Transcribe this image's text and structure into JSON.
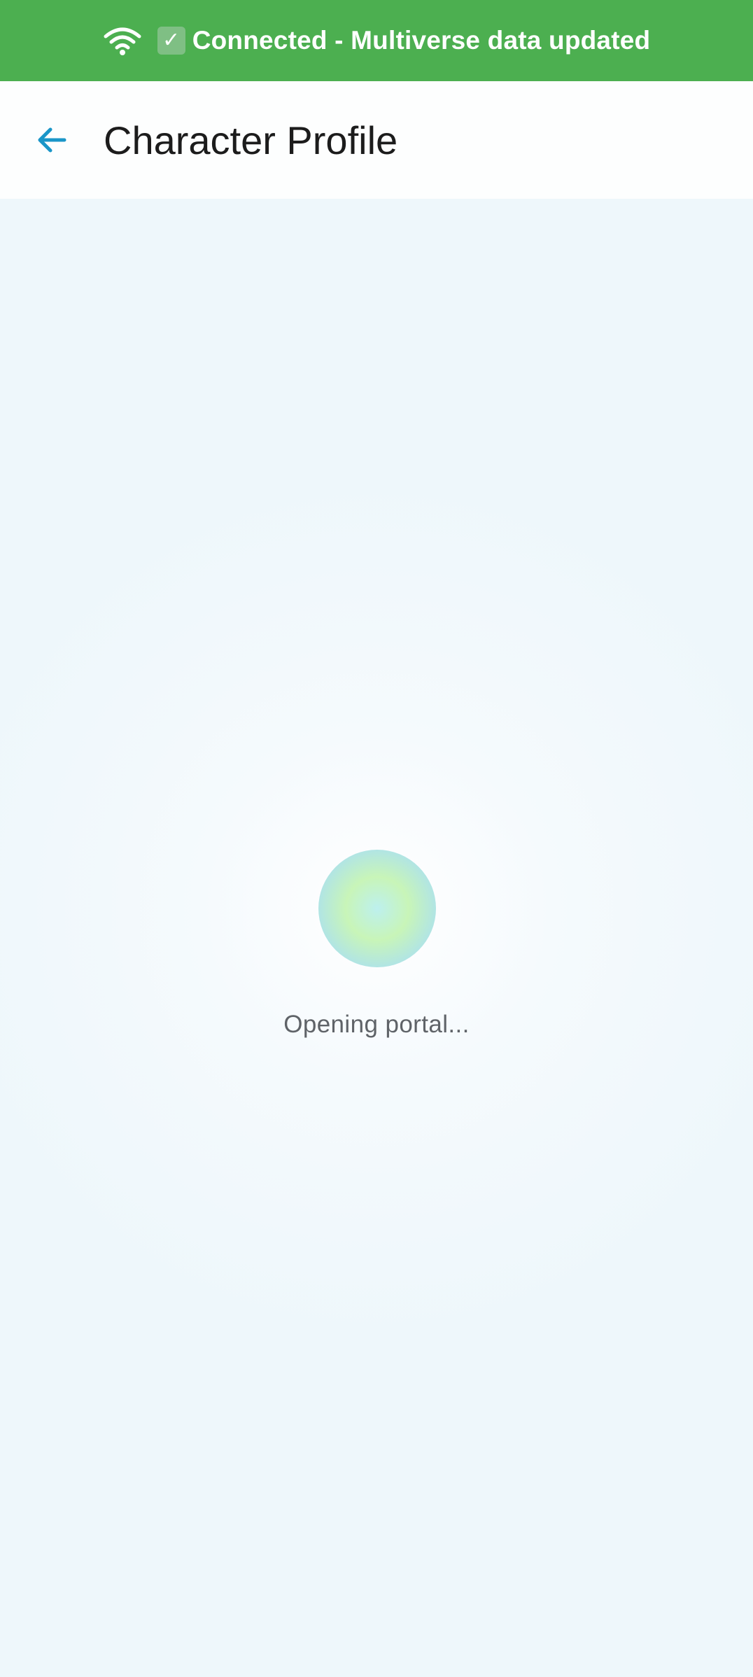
{
  "banner": {
    "icon": "wifi-icon",
    "check_icon": "check-mark-icon",
    "check_glyph": "✓",
    "text": "Connected - Multiverse data updated",
    "background": "#4caf50"
  },
  "app_bar": {
    "back_icon": "arrow-left-icon",
    "title": "Character Profile",
    "accent": "#1a96c8"
  },
  "loading": {
    "text": "Opening portal..."
  }
}
